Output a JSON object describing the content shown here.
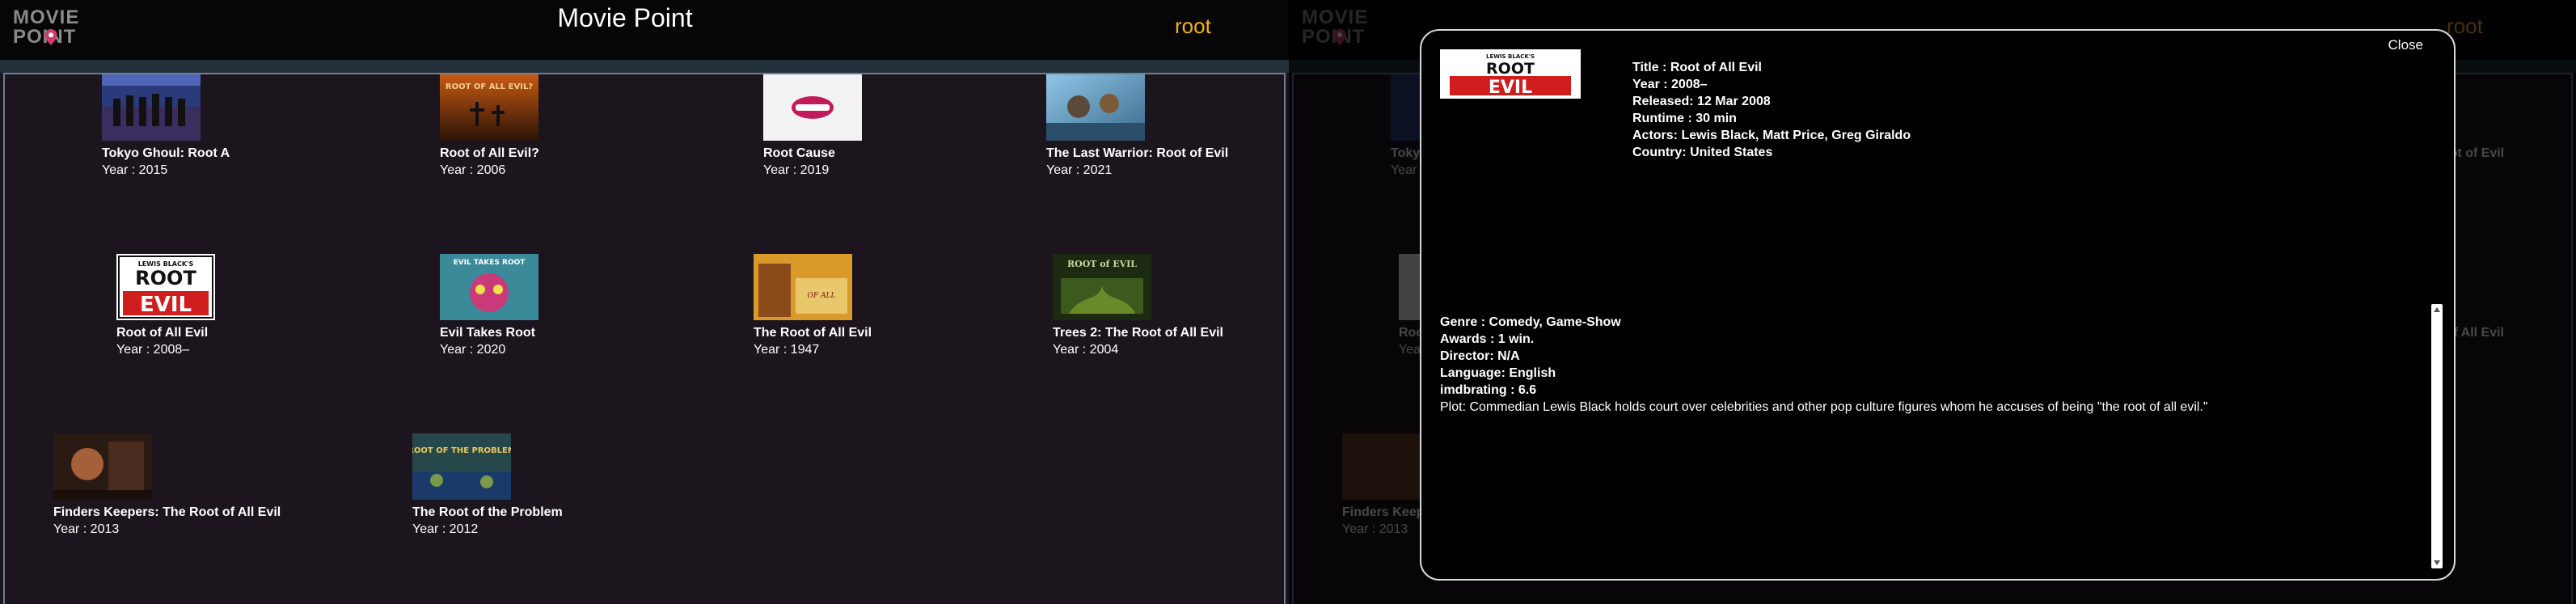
{
  "app": {
    "logo_line1": "MOVIE",
    "logo_line2": "POINT",
    "title": "Movie Point",
    "search_value": "root",
    "accent_color": "#f2b21b"
  },
  "results": [
    {
      "title": "Tokyo Ghoul: Root A",
      "year_label": "Year : 2015"
    },
    {
      "title": "Root of All Evil?",
      "year_label": "Year : 2006"
    },
    {
      "title": "Root Cause",
      "year_label": "Year : 2019"
    },
    {
      "title": "The Last Warrior: Root of Evil",
      "year_label": "Year : 2021"
    },
    {
      "title": "Root of All Evil",
      "year_label": "Year : 2008–"
    },
    {
      "title": "Evil Takes Root",
      "year_label": "Year : 2020"
    },
    {
      "title": "The Root of All Evil",
      "year_label": "Year : 1947"
    },
    {
      "title": "Trees 2: The Root of All Evil",
      "year_label": "Year : 2004"
    },
    {
      "title": "Finders Keepers: The Root of All Evil",
      "year_label": "Year : 2013"
    },
    {
      "title": "The Root of the Problem",
      "year_label": "Year : 2012"
    }
  ],
  "poster_texts": {
    "root_line1": "LEWIS BLACK'S",
    "root_line2": "ROOT",
    "root_line3": "EVIL",
    "root_of": "OF ALL",
    "evil_takes_root": "EVIL TAKES ROOT",
    "root_of_evil": "ROOT OF ALL EVIL?",
    "trees_root": "ROOT of EVIL",
    "root_problem": "ROOT OF THE PROBLEM"
  },
  "modal": {
    "close_label": "Close",
    "title_line": "Title : Root of All Evil",
    "year_line": "Year : 2008–",
    "released_line": "Released: 12 Mar 2008",
    "runtime_line": "Runtime : 30 min",
    "actors_line": "Actors: Lewis Black, Matt Price, Greg Giraldo",
    "country_line": "Country: United States",
    "genre_line": "Genre : Comedy, Game-Show",
    "awards_line": "Awards : 1 win.",
    "director_line": "Director: N/A",
    "language_line": "Language: English",
    "rating_line": "imdbrating : 6.6",
    "plot_line": "Plot: Commedian Lewis Black holds court over celebrities and other pop culture figures whom he accuses of being \"the root of all evil.\""
  }
}
